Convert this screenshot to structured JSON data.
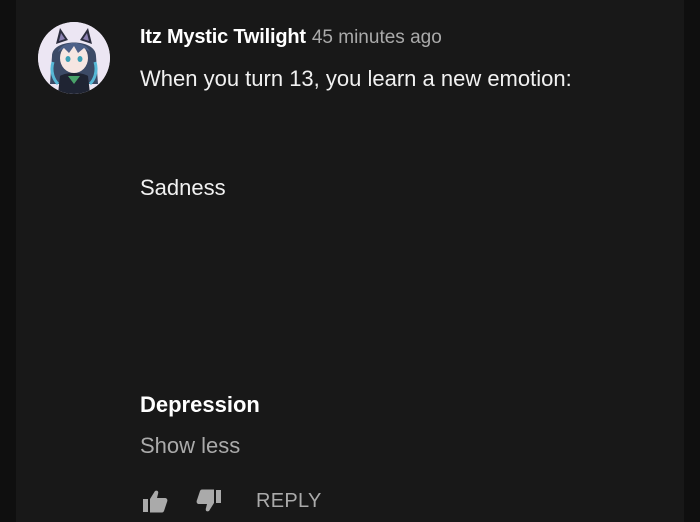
{
  "comment": {
    "author": "Itz Mystic Twilight",
    "timestamp": "45 minutes ago",
    "lines": [
      "When you turn 13, you learn a new emotion:",
      "Sadness",
      "Depression"
    ],
    "show_less_label": "Show less",
    "actions": {
      "like_icon": "thumbs-up-icon",
      "dislike_icon": "thumbs-down-icon",
      "reply_label": "REPLY"
    }
  },
  "colors": {
    "background": "#181818",
    "page_edge": "#0f0f0f",
    "text_primary": "#f1f1f1",
    "text_secondary": "#aaaaaa"
  }
}
